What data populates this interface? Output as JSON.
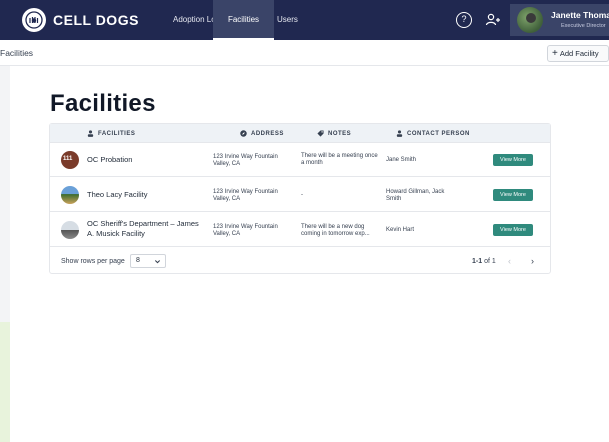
{
  "app": {
    "brand": "CELL DOGS"
  },
  "nav": {
    "items": [
      {
        "label": "Adoption Log"
      },
      {
        "label": "Facilities"
      },
      {
        "label": "Users"
      }
    ],
    "active": "Facilities"
  },
  "user": {
    "name": "Janette Thomas",
    "role": "Executive Director"
  },
  "breadcrumb": "Facilities",
  "actions": {
    "add_facility": "Add Facility"
  },
  "page": {
    "title": "Facilities"
  },
  "table": {
    "headers": {
      "facilities": "FACILITIES",
      "address": "ADDRESS",
      "notes": "NOTES",
      "contact": "CONTACT PERSON"
    },
    "rows": [
      {
        "name": "OC Probation",
        "address": "123 Irvine Way Fountain Valley, CA",
        "notes": "There will be a meeting once a month",
        "contact": "Jane Smith",
        "action": "View More"
      },
      {
        "name": "Theo Lacy Facility",
        "address": "123 Irvine Way Fountain Valley, CA",
        "notes": "-",
        "contact": "Howard Gillman, Jack Smith",
        "action": "View More"
      },
      {
        "name": "OC Sheriff's Department – James A. Musick Facility",
        "address": "123 Irvine Way Fountain Valley, CA",
        "notes": "There will be a new dog coming in tomorrow exp...",
        "contact": "Kevin Hart",
        "action": "View More"
      }
    ]
  },
  "pagination": {
    "rows_label": "Show rows per page",
    "rows_value": "8",
    "range_bold": "1-1",
    "range_rest": "of 1"
  },
  "colors": {
    "nav_bg": "#202850",
    "accent": "#2f8a7d",
    "header_bg": "#eef2f6"
  }
}
